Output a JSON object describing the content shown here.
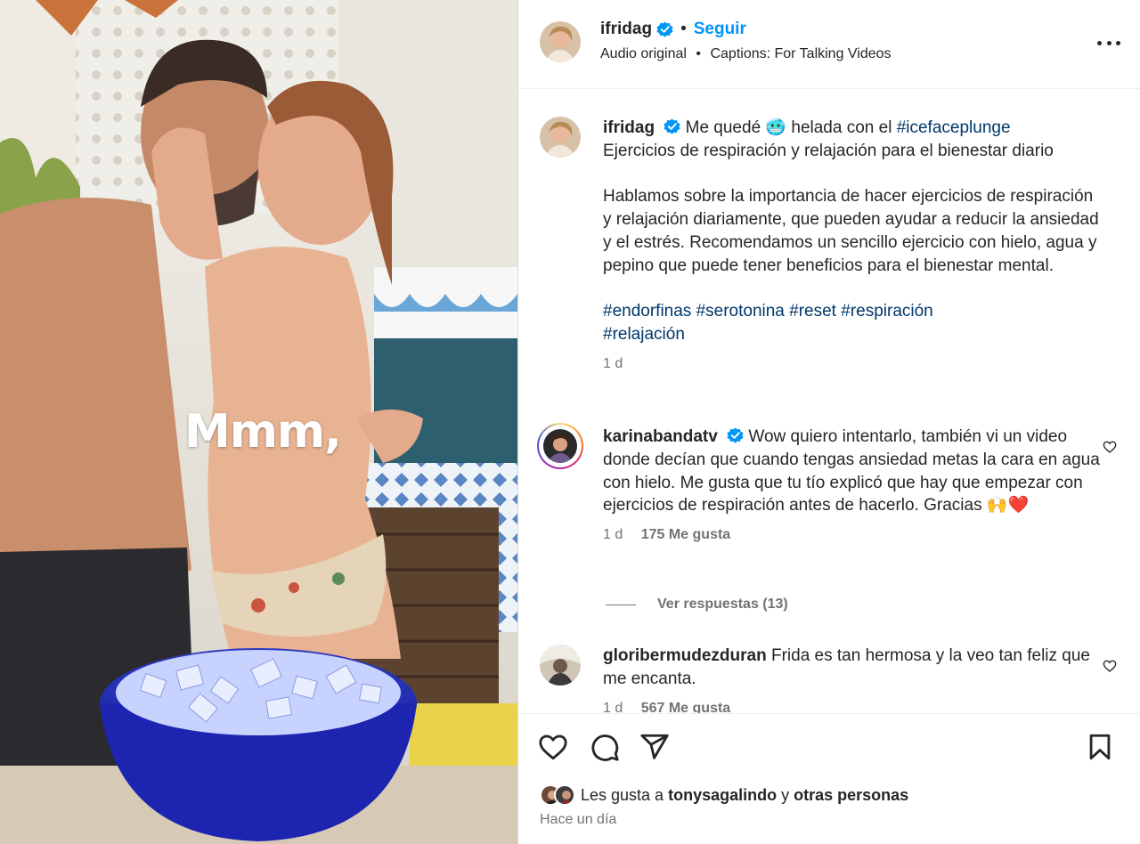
{
  "media": {
    "caption_overlay": "Mmm,"
  },
  "header": {
    "username": "ifridag",
    "separator": "•",
    "follow_label": "Seguir",
    "audio_label": "Audio original",
    "captions_label": "Captions: For Talking Videos",
    "more_icon": "more-horizontal-icon"
  },
  "caption": {
    "username": "ifridag",
    "text_before": "Me quedé",
    "emoji": "🥶",
    "text_after": "helada con el",
    "hashtag_main": "#icefaceplunge",
    "line2": "Ejercicios de respiración y relajación para el bienestar diario",
    "paragraph": "Hablamos sobre la importancia de hacer ejercicios de respiración y relajación diariamente, que pueden ayudar a reducir la ansiedad y el estrés. Recomendamos un sencillo ejercicio con hielo, agua y pepino que puede tener beneficios para el bienestar mental.",
    "hashtags": [
      "#endorfinas",
      "#serotonina",
      "#reset",
      "#respiración",
      "#relajación"
    ],
    "time": "1 d"
  },
  "comments": [
    {
      "username": "karinabandatv",
      "verified": true,
      "text": "Wow quiero intentarlo, también vi un video donde decían que cuando tengas ansiedad metas la cara en agua con hielo. Me gusta que tu tío explicó que hay que empezar con ejercicios de respiración antes de hacerlo. Gracias 🙌❤️",
      "time": "1 d",
      "likes": "175 Me gusta",
      "replies_label": "Ver respuestas (13)"
    },
    {
      "username": "gloribermudezduran",
      "verified": false,
      "text": "Frida es tan hermosa y la veo tan feliz que me encanta.",
      "time": "1 d",
      "likes": "567 Me gusta"
    }
  ],
  "actions": {
    "icons": [
      "heart-icon",
      "comment-icon",
      "share-icon",
      "bookmark-icon"
    ],
    "likes_prefix": "Les gusta a",
    "likes_user": "tonysagalindo",
    "likes_connector": "y",
    "likes_others": "otras personas",
    "time_ago": "Hace un día"
  },
  "colors": {
    "accent": "#0095f6",
    "hashtag": "#00376b",
    "text": "#262626",
    "secondary": "#737373",
    "verified": "#0095f6"
  }
}
